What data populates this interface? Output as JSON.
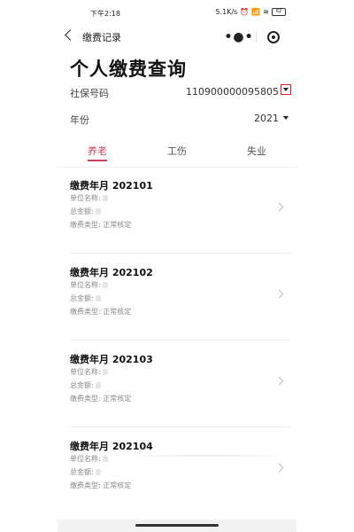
{
  "status_bar": {
    "time": "下午2:18",
    "speed": "5.1K/s",
    "battery": "62"
  },
  "nav": {
    "title": "缴费记录"
  },
  "page": {
    "title": "个人缴费查询"
  },
  "fields": {
    "ssn_label": "社保号码",
    "ssn_value": "110900000095805",
    "year_label": "年份",
    "year_value": "2021"
  },
  "tabs": [
    {
      "label": "养老"
    },
    {
      "label": "工伤"
    },
    {
      "label": "失业"
    }
  ],
  "records": [
    {
      "month": "缴费年月 202101",
      "company_label": "单位名称:",
      "total_label": "总金额:",
      "type_label": "缴费类型:",
      "type_value": "正常核定"
    },
    {
      "month": "缴费年月 202102",
      "company_label": "单位名称:",
      "total_label": "总金额:",
      "type_label": "缴费类型:",
      "type_value": "正常核定"
    },
    {
      "month": "缴费年月 202103",
      "company_label": "单位名称:",
      "total_label": "总金额:",
      "type_label": "缴费类型:",
      "type_value": "正常核定"
    },
    {
      "month": "缴费年月 202104",
      "company_label": "单位名称:",
      "total_label": "总金额:",
      "type_label": "缴费类型:",
      "type_value": "正常核定"
    }
  ],
  "colors": {
    "accent": "#c9405a",
    "highlight_box": "#e02020"
  }
}
